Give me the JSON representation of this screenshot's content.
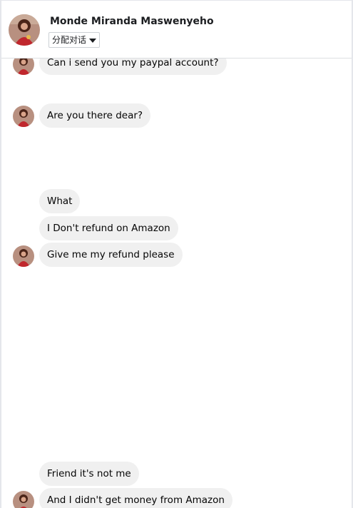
{
  "contact": {
    "name": "Monde Miranda Maswenyeho",
    "assign_label": "分配对话"
  },
  "messages": [
    {
      "text": "Can i send you my paypal account?"
    },
    {
      "text": "Are you there dear?"
    },
    {
      "text": "What"
    },
    {
      "text": "I Don't refund on Amazon"
    },
    {
      "text": "Give me my refund please"
    },
    {
      "text": "Friend it's not me"
    },
    {
      "text": "And I didn't get money from Amazon"
    }
  ],
  "colors": {
    "bubble_bg": "#f0f0f0",
    "text": "#050505",
    "divider": "#dddfe2"
  },
  "icons": {
    "dropdown": "chevron-down-icon",
    "avatar": "avatar"
  }
}
